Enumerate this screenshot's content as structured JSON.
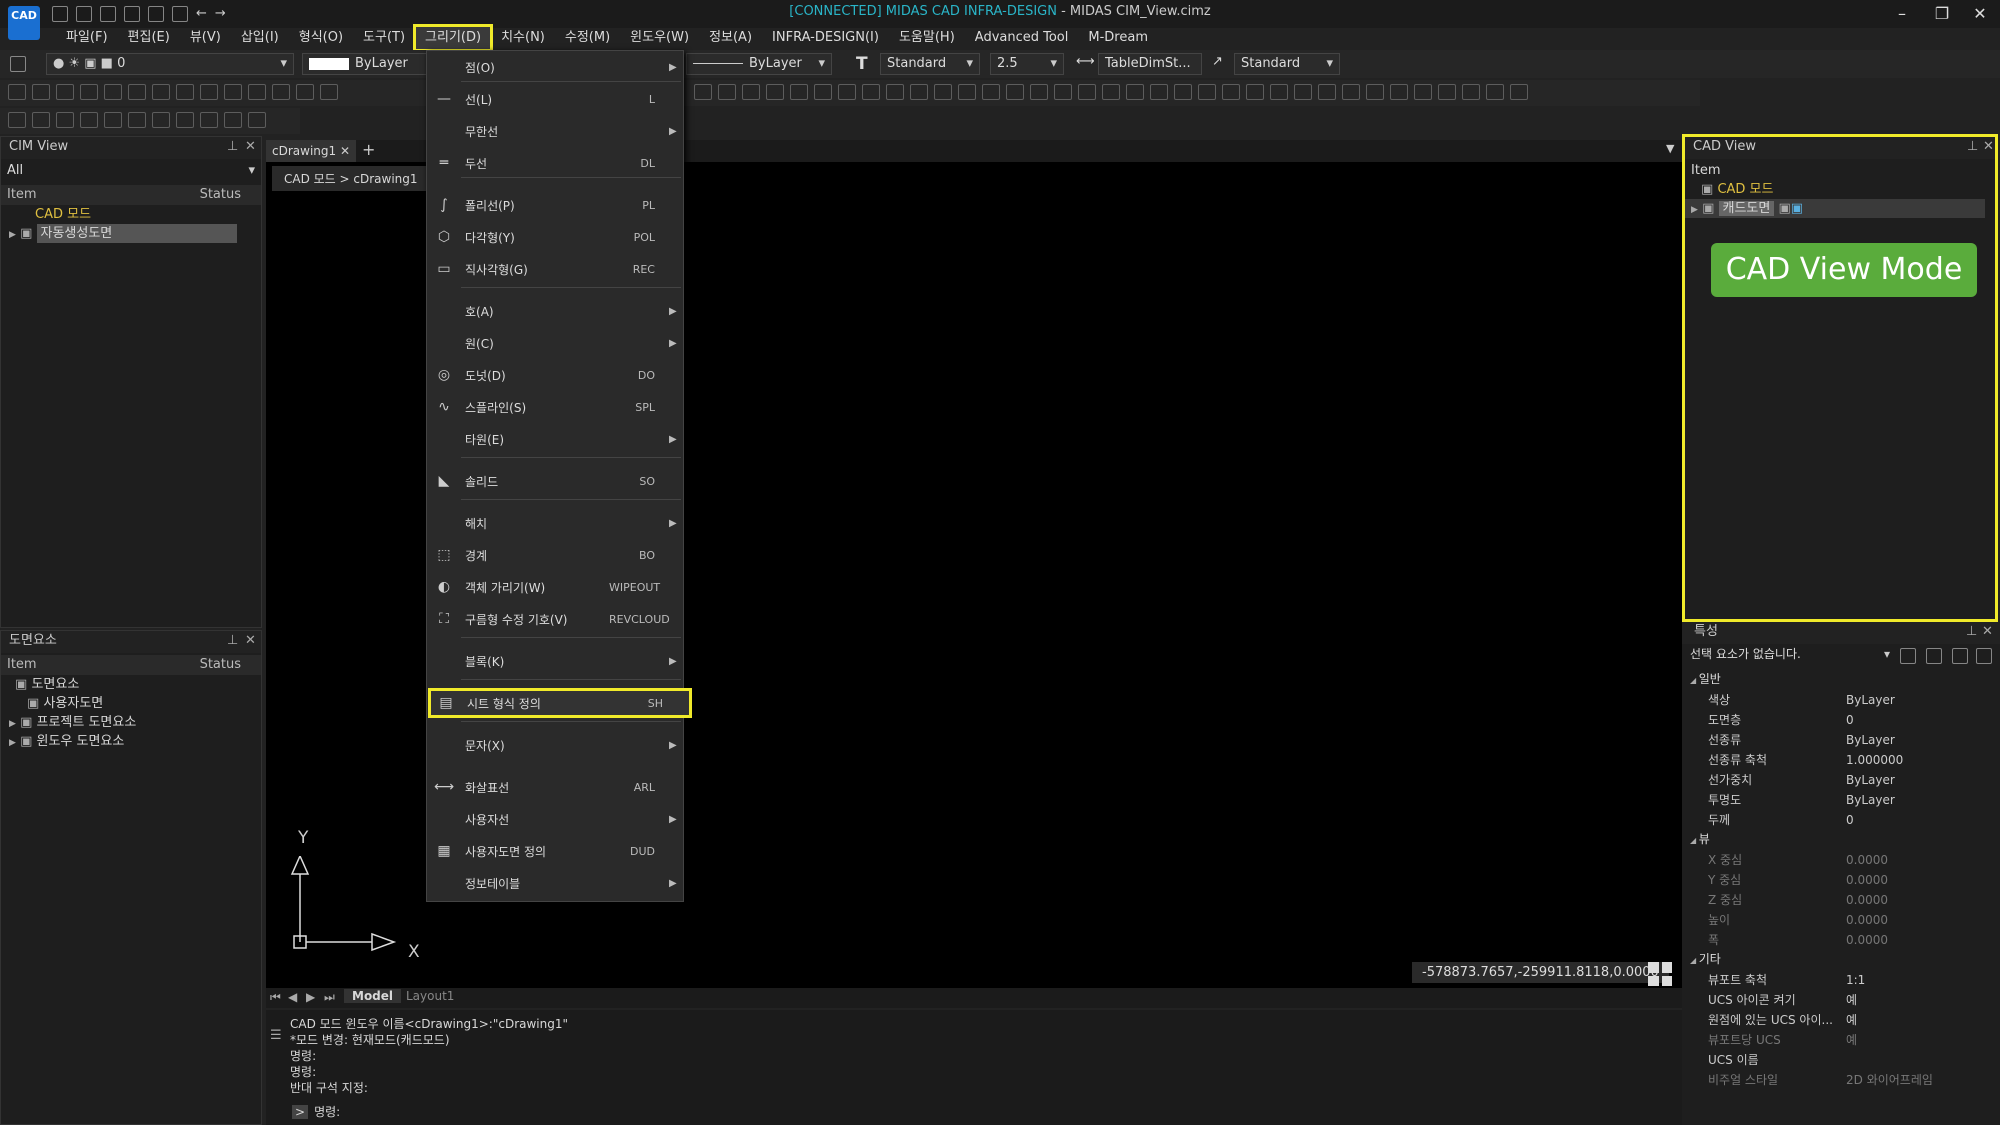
{
  "titlebar": {
    "connected": "[CONNECTED] MIDAS CAD INFRA-DESIGN",
    "title": " - MIDAS CIM_View.cimz",
    "logo": "CAD",
    "min": "–",
    "max": "❐",
    "close": "✕"
  },
  "menu": [
    "파일(F)",
    "편집(E)",
    "뷰(V)",
    "삽입(I)",
    "형식(O)",
    "도구(T)",
    "그리기(D)",
    "치수(N)",
    "수정(M)",
    "윈도우(W)",
    "정보(A)",
    "INFRA-DESIGN(I)",
    "도움말(H)",
    "Advanced Tool",
    "M-Dream"
  ],
  "toolbar": {
    "layer": "0",
    "color": "ByLayer",
    "linetype": "ByLayer",
    "textstyle": "Standard",
    "textheight": "2.5",
    "dimstyle": "TableDimSt...",
    "mleaderstyle": "Standard"
  },
  "drawmenu": [
    {
      "icon": "",
      "label": "점(O)",
      "sc": "",
      "sub": true
    },
    {
      "icon": "—",
      "label": "선(L)",
      "sc": "L",
      "sub": false
    },
    {
      "icon": "",
      "label": "무한선",
      "sc": "",
      "sub": true
    },
    {
      "icon": "═",
      "label": "두선",
      "sc": "DL",
      "sub": false
    },
    {
      "icon": "∫",
      "label": "폴리선(P)",
      "sc": "PL",
      "sub": false
    },
    {
      "icon": "⬡",
      "label": "다각형(Y)",
      "sc": "POL",
      "sub": false
    },
    {
      "icon": "▭",
      "label": "직사각형(G)",
      "sc": "REC",
      "sub": false
    },
    {
      "icon": "",
      "label": "호(A)",
      "sc": "",
      "sub": true
    },
    {
      "icon": "",
      "label": "원(C)",
      "sc": "",
      "sub": true
    },
    {
      "icon": "◎",
      "label": "도넛(D)",
      "sc": "DO",
      "sub": false
    },
    {
      "icon": "∿",
      "label": "스플라인(S)",
      "sc": "SPL",
      "sub": false
    },
    {
      "icon": "",
      "label": "타원(E)",
      "sc": "",
      "sub": true
    },
    {
      "icon": "◣",
      "label": "솔리드",
      "sc": "SO",
      "sub": false
    },
    {
      "icon": "",
      "label": "해치",
      "sc": "",
      "sub": true
    },
    {
      "icon": "⬚",
      "label": "경계",
      "sc": "BO",
      "sub": false
    },
    {
      "icon": "◐",
      "label": "객체 가리기(W)",
      "sc": "WIPEOUT",
      "sub": false
    },
    {
      "icon": "⛶",
      "label": "구름형 수정 기호(V)",
      "sc": "REVCLOUD",
      "sub": false
    },
    {
      "icon": "",
      "label": "블록(K)",
      "sc": "",
      "sub": true
    },
    {
      "icon": "▤",
      "label": "시트 형식 정의",
      "sc": "SH",
      "sub": false
    },
    {
      "icon": "",
      "label": "문자(X)",
      "sc": "",
      "sub": true
    },
    {
      "icon": "⟷",
      "label": "화살표선",
      "sc": "ARL",
      "sub": false
    },
    {
      "icon": "",
      "label": "사용자선",
      "sc": "",
      "sub": true
    },
    {
      "icon": "▦",
      "label": "사용자도면 정의",
      "sc": "DUD",
      "sub": false
    },
    {
      "icon": "",
      "label": "정보테이블",
      "sc": "",
      "sub": true
    }
  ],
  "cimview": {
    "title": "CIM View",
    "filter": "All",
    "col_item": "Item",
    "col_status": "Status",
    "root": "CAD 모드",
    "child": "자동생성도면"
  },
  "elements": {
    "title": "도면요소",
    "col_item": "Item",
    "col_status": "Status",
    "items": [
      "도면요소",
      "사용자도면",
      "프로젝트 도면요소",
      "윈도우 도면요소"
    ]
  },
  "tabs": {
    "doc": "cDrawing1",
    "breadcrumb": "CAD 모드 > cDrawing1",
    "model": "Model",
    "layout": "Layout1"
  },
  "cadview": {
    "title": "CAD View",
    "item": "Item",
    "root": "CAD 모드",
    "child": "캐드도면",
    "button": "CAD View Mode"
  },
  "props": {
    "title": "특성",
    "select": "선택 요소가 없습니다.",
    "general": "일반",
    "rows_general": [
      [
        "색상",
        "ByLayer"
      ],
      [
        "도면층",
        "0"
      ],
      [
        "선종류",
        "ByLayer"
      ],
      [
        "선종류 축척",
        "1.000000"
      ],
      [
        "선가중치",
        "ByLayer"
      ],
      [
        "투명도",
        "ByLayer"
      ],
      [
        "두께",
        "0"
      ]
    ],
    "view": "뷰",
    "rows_view": [
      [
        "X 중심",
        "0.0000"
      ],
      [
        "Y 중심",
        "0.0000"
      ],
      [
        "Z 중심",
        "0.0000"
      ],
      [
        "높이",
        "0.0000"
      ],
      [
        "폭",
        "0.0000"
      ]
    ],
    "misc": "기타",
    "rows_misc": [
      [
        "뷰포트 축척",
        "1:1"
      ],
      [
        "UCS 아이콘 켜기",
        "예"
      ],
      [
        "원점에 있는 UCS 아이...",
        "예"
      ],
      [
        "뷰포트당 UCS",
        "예"
      ],
      [
        "UCS 이름",
        ""
      ],
      [
        "비주얼 스타일",
        "2D 와이어프레임"
      ]
    ]
  },
  "coords": "-578873.7657,-259911.8118,0.0000",
  "cmd": {
    "lines": [
      "CAD 모드 윈도우 이름<cDrawing1>:\"cDrawing1\"",
      "*모드 변경: 현재모드(캐드모드)",
      "명령:",
      "명령:",
      "반대 구석 지정:"
    ],
    "prompt": "명령:"
  },
  "axis": {
    "x": "X",
    "y": "Y"
  }
}
